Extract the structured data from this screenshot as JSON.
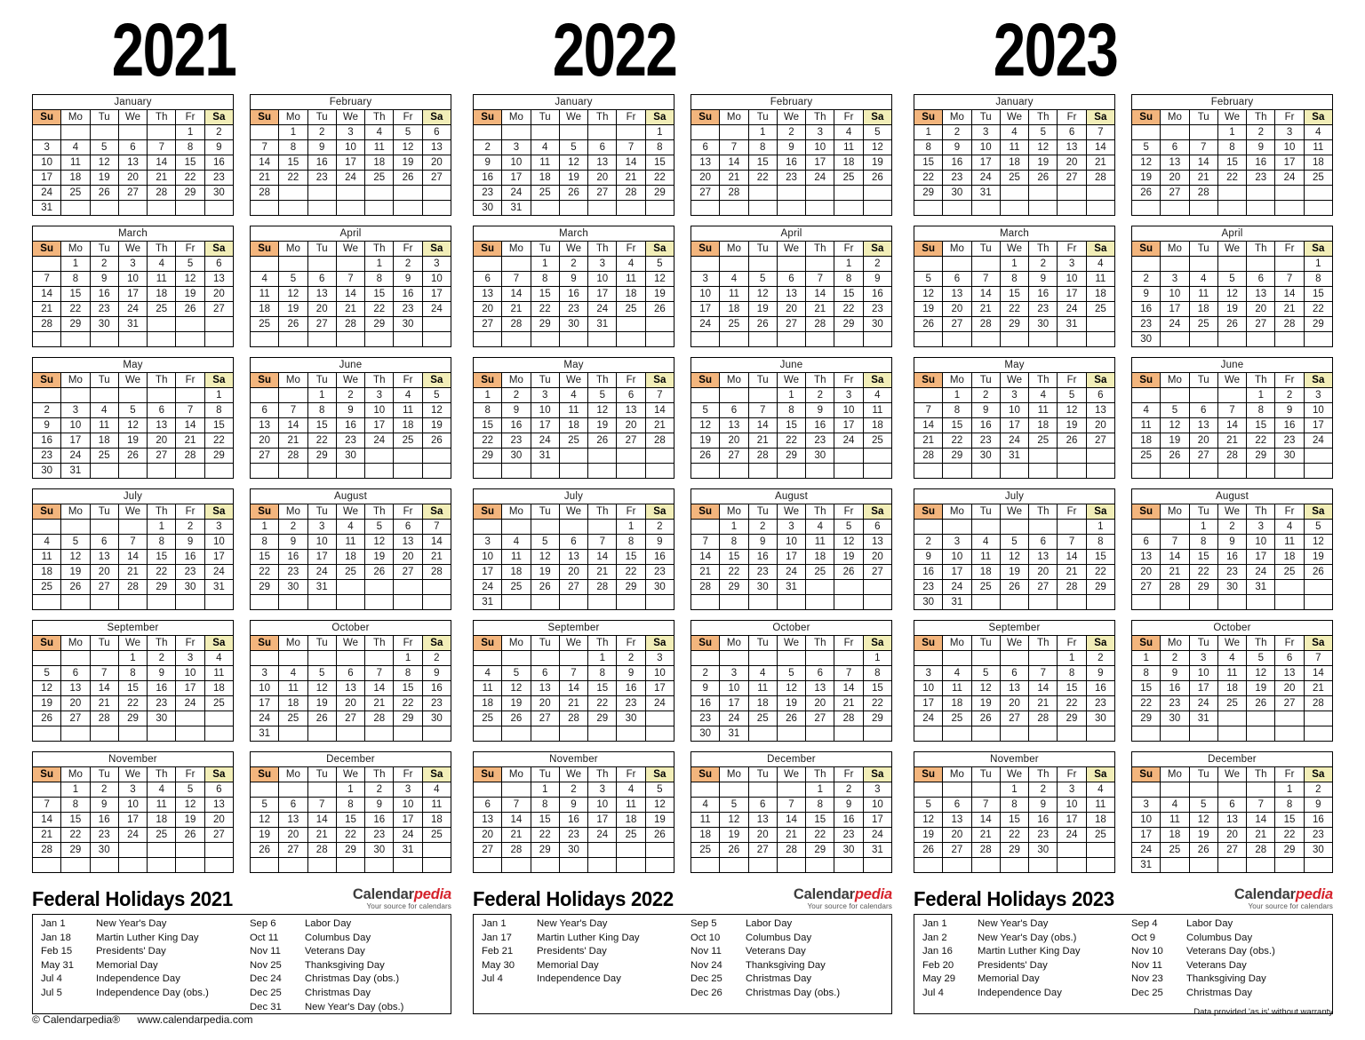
{
  "meta": {
    "footer_copyright": "© Calendarpedia®",
    "footer_url": "www.calendarpedia.com",
    "disclaimer": "Data provided 'as is' without warranty",
    "logo_main": "Calendar",
    "logo_accent": "pedia",
    "logo_tagline": "Your source for calendars",
    "colors": {
      "sunday": "#f9c691",
      "saturday": "#f8f4cd",
      "holiday_bg": "#fadadd",
      "holiday_text": "#e01b2e",
      "dow_header": "#e8e8e8",
      "accent_red": "#d5232c"
    }
  },
  "dow": [
    "Su",
    "Mo",
    "Tu",
    "We",
    "Th",
    "Fr",
    "Sa"
  ],
  "month_names": [
    "January",
    "February",
    "March",
    "April",
    "May",
    "June",
    "July",
    "August",
    "September",
    "October",
    "November",
    "December"
  ],
  "years": [
    {
      "year": "2021",
      "first_weekday": 5,
      "leap": false,
      "holidays_title": "Federal Holidays 2021",
      "holiday_days": {
        "1": [
          1,
          18
        ],
        "2": [
          15
        ],
        "5": [
          31
        ],
        "7": [
          4,
          5
        ],
        "9": [
          6
        ],
        "10": [
          11
        ],
        "11": [
          11,
          25
        ],
        "12": [
          24,
          25,
          31
        ]
      },
      "holidays_left": [
        {
          "date": "Jan 1",
          "name": "New Year's Day"
        },
        {
          "date": "Jan 18",
          "name": "Martin Luther King Day"
        },
        {
          "date": "Feb 15",
          "name": "Presidents' Day"
        },
        {
          "date": "May 31",
          "name": "Memorial Day"
        },
        {
          "date": "Jul 4",
          "name": "Independence Day"
        },
        {
          "date": "Jul 5",
          "name": "Independence Day (obs.)"
        }
      ],
      "holidays_right": [
        {
          "date": "Sep 6",
          "name": "Labor Day"
        },
        {
          "date": "Oct 11",
          "name": "Columbus Day"
        },
        {
          "date": "Nov 11",
          "name": "Veterans Day"
        },
        {
          "date": "Nov 25",
          "name": "Thanksgiving Day"
        },
        {
          "date": "Dec 24",
          "name": "Christmas Day (obs.)"
        },
        {
          "date": "Dec 25",
          "name": "Christmas Day"
        },
        {
          "date": "Dec 31",
          "name": "New Year's Day (obs.)"
        }
      ]
    },
    {
      "year": "2022",
      "first_weekday": 6,
      "leap": false,
      "holidays_title": "Federal Holidays 2022",
      "holiday_days": {
        "1": [
          1,
          17
        ],
        "2": [
          21
        ],
        "5": [
          30
        ],
        "7": [
          4
        ],
        "9": [
          5
        ],
        "10": [
          10
        ],
        "11": [
          11,
          24
        ],
        "12": [
          25,
          26
        ]
      },
      "holidays_left": [
        {
          "date": "Jan 1",
          "name": "New Year's Day"
        },
        {
          "date": "Jan 17",
          "name": "Martin Luther King Day"
        },
        {
          "date": "Feb 21",
          "name": "Presidents' Day"
        },
        {
          "date": "May 30",
          "name": "Memorial Day"
        },
        {
          "date": "Jul 4",
          "name": "Independence Day"
        }
      ],
      "holidays_right": [
        {
          "date": "Sep 5",
          "name": "Labor Day"
        },
        {
          "date": "Oct 10",
          "name": "Columbus Day"
        },
        {
          "date": "Nov 11",
          "name": "Veterans Day"
        },
        {
          "date": "Nov 24",
          "name": "Thanksgiving Day"
        },
        {
          "date": "Dec 25",
          "name": "Christmas Day"
        },
        {
          "date": "Dec 26",
          "name": "Christmas Day (obs.)"
        }
      ]
    },
    {
      "year": "2023",
      "first_weekday": 0,
      "leap": false,
      "holidays_title": "Federal Holidays 2023",
      "holiday_days": {
        "1": [
          1,
          2,
          16
        ],
        "2": [
          20
        ],
        "5": [
          29
        ],
        "7": [
          4
        ],
        "9": [
          4
        ],
        "10": [
          9
        ],
        "11": [
          10,
          11,
          23
        ],
        "12": [
          25
        ]
      },
      "holidays_left": [
        {
          "date": "Jan 1",
          "name": "New Year's Day"
        },
        {
          "date": "Jan 2",
          "name": "New Year's Day (obs.)"
        },
        {
          "date": "Jan 16",
          "name": "Martin Luther King Day"
        },
        {
          "date": "Feb 20",
          "name": "Presidents' Day"
        },
        {
          "date": "May 29",
          "name": "Memorial Day"
        },
        {
          "date": "Jul 4",
          "name": "Independence Day"
        }
      ],
      "holidays_right": [
        {
          "date": "Sep 4",
          "name": "Labor Day"
        },
        {
          "date": "Oct 9",
          "name": "Columbus Day"
        },
        {
          "date": "Nov 10",
          "name": "Veterans Day (obs.)"
        },
        {
          "date": "Nov 11",
          "name": "Veterans Day"
        },
        {
          "date": "Nov 23",
          "name": "Thanksgiving Day"
        },
        {
          "date": "Dec 25",
          "name": "Christmas Day"
        }
      ]
    }
  ]
}
